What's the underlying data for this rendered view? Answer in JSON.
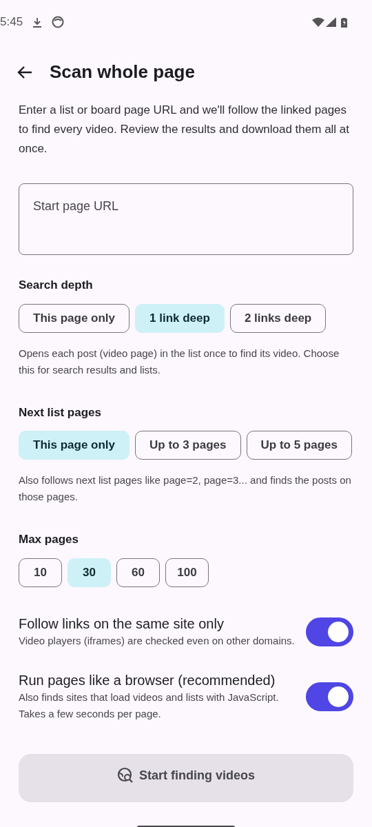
{
  "status_bar": {
    "time": "5:45"
  },
  "title": "Scan whole page",
  "description": "Enter a list or board page URL and we'll follow the linked pages to find every video. Review the results and download them all at once.",
  "url_field": {
    "placeholder": "Start page URL"
  },
  "groups": [
    {
      "label": "Search depth",
      "options": [
        {
          "label": "This page only",
          "selected": false
        },
        {
          "label": "1 link deep",
          "selected": true
        },
        {
          "label": "2 links deep",
          "selected": false
        }
      ],
      "help": "Opens each post (video page) in the list once to find its video. Choose this for search results and lists."
    },
    {
      "label": "Next list pages",
      "options": [
        {
          "label": "This page only",
          "selected": true
        },
        {
          "label": "Up to 3 pages",
          "selected": false
        },
        {
          "label": "Up to 5 pages",
          "selected": false
        }
      ],
      "help": "Also follows next list pages like page=2, page=3... and finds the posts on those pages."
    },
    {
      "label": "Max pages",
      "options": [
        {
          "label": "10",
          "selected": false
        },
        {
          "label": "30",
          "selected": true
        },
        {
          "label": "60",
          "selected": false
        },
        {
          "label": "100",
          "selected": false
        }
      ]
    }
  ],
  "toggles": [
    {
      "title": "Follow links on the same site only",
      "subtitle": "Video players (iframes) are checked even on other domains.",
      "on": true
    },
    {
      "title": "Run pages like a browser (recommended)",
      "subtitle": "Also finds sites that load videos and lists with JavaScript. Takes a few seconds per page.",
      "on": true
    }
  ],
  "start_button": {
    "label": "Start finding videos",
    "disabled": true
  }
}
